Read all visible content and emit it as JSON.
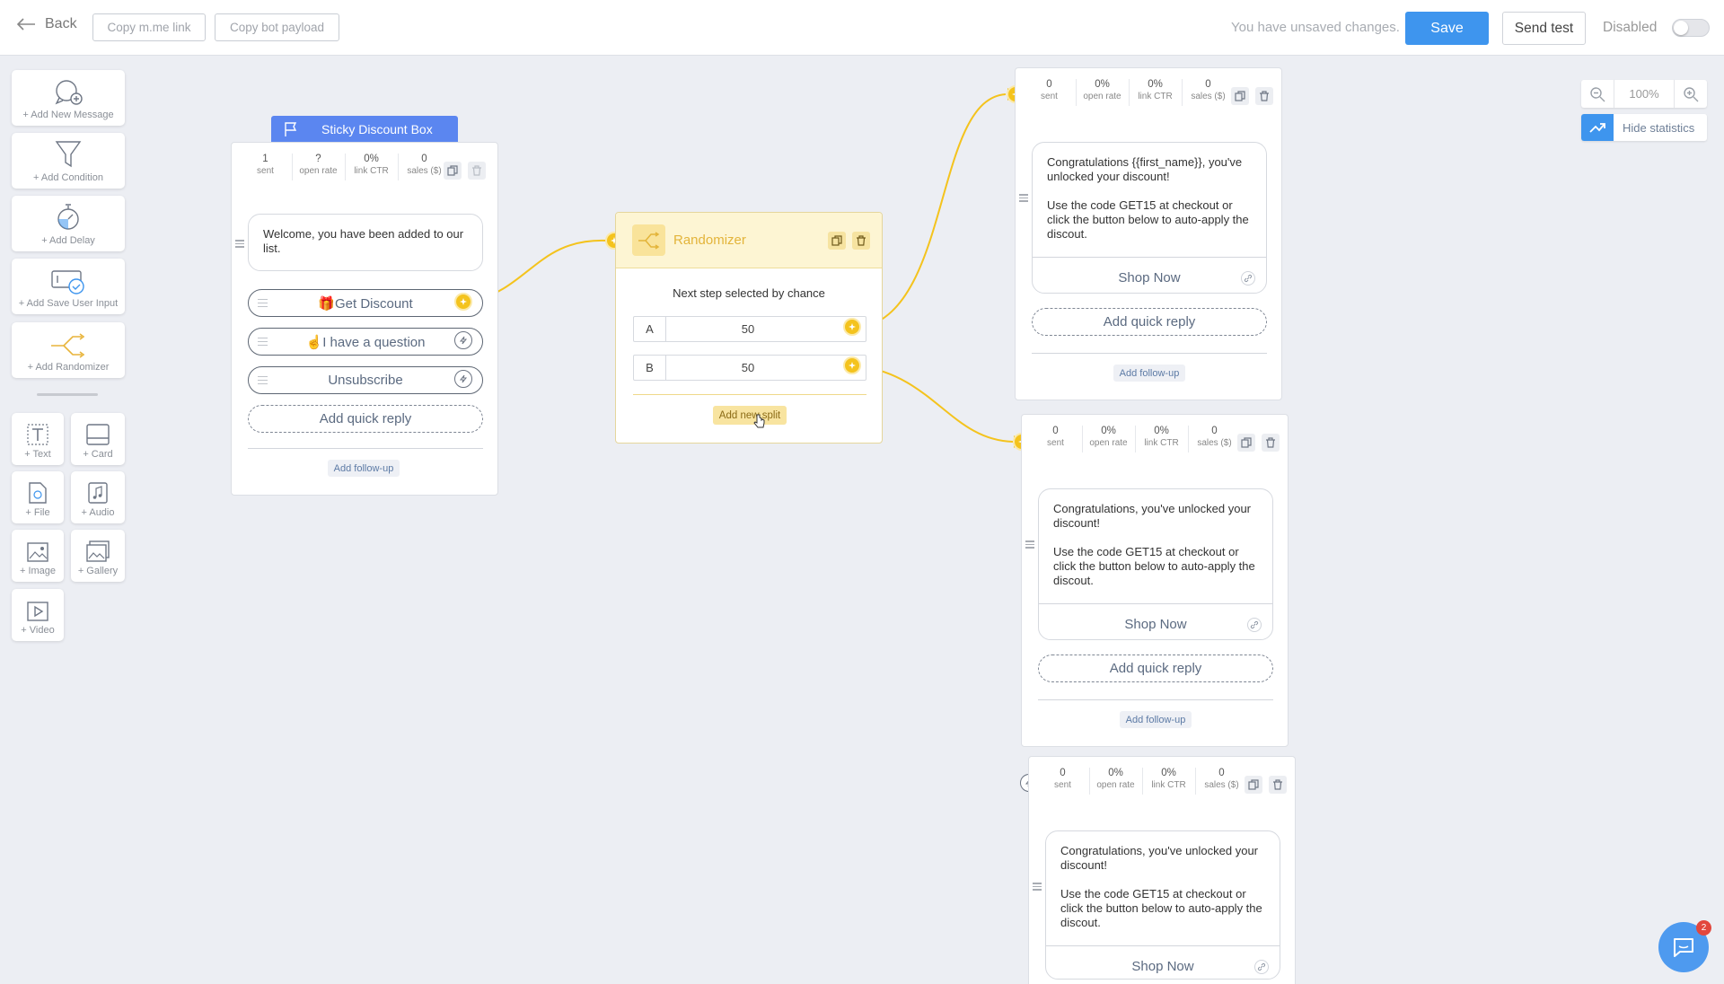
{
  "topbar": {
    "back": "Back",
    "copy_link": "Copy m.me link",
    "copy_payload": "Copy bot payload",
    "unsaved": "You have unsaved changes.",
    "save": "Save",
    "send_test": "Send test",
    "disabled": "Disabled"
  },
  "palette": {
    "add_message": "+ Add New Message",
    "add_condition": "+ Add Condition",
    "add_delay": "+ Add Delay",
    "add_save_input": "+ Add Save User Input",
    "add_randomizer": "+ Add Randomizer",
    "text": "+ Text",
    "card": "+ Card",
    "file": "+ File",
    "audio": "+ Audio",
    "image": "+ Image",
    "gallery": "+ Gallery",
    "video": "+ Video"
  },
  "zoom": {
    "value": "100%",
    "hide_stats": "Hide statistics"
  },
  "stat_labels": {
    "sent": "sent",
    "open": "open rate",
    "ctr": "link CTR",
    "sales": "sales ($)"
  },
  "sticky": {
    "title": "Sticky Discount Box",
    "sent": "1",
    "open": "?",
    "ctr": "0%",
    "sales": "0",
    "message": "Welcome, you have been added to our list.",
    "qr1": "🎁Get Discount",
    "qr2": "☝️I have a question",
    "qr3": "Unsubscribe",
    "add_qr": "Add quick reply",
    "followup": "Add follow-up"
  },
  "randomizer": {
    "title": "Randomizer",
    "subtitle": "Next step selected by chance",
    "a_label": "A",
    "a_value": "50",
    "b_label": "B",
    "b_value": "50",
    "pct": "%",
    "add_split": "Add new split"
  },
  "msg1": {
    "sent": "0",
    "open": "0%",
    "ctr": "0%",
    "sales": "0",
    "line1": "Congratulations {{first_name}}, you've unlocked your discount!",
    "line2": "Use the code GET15 at checkout or click the button below to auto-apply the discout.",
    "shop": "Shop Now",
    "add_qr": "Add quick reply",
    "followup": "Add follow-up"
  },
  "msg2": {
    "sent": "0",
    "open": "0%",
    "ctr": "0%",
    "sales": "0",
    "line1": "Congratulations, you've unlocked your discount!",
    "line2": "Use the code GET15 at checkout or click the button below to auto-apply the discout.",
    "shop": "Shop Now",
    "add_qr": "Add quick reply",
    "followup": "Add follow-up"
  },
  "msg3": {
    "sent": "0",
    "open": "0%",
    "ctr": "0%",
    "sales": "0",
    "line1": "Congratulations, you've unlocked your discount!",
    "line2": "Use the code GET15 at checkout or click the button below to auto-apply the discout.",
    "shop": "Shop Now"
  },
  "chat": {
    "badge": "2"
  },
  "colors": {
    "accent": "#3e95ee",
    "connector": "#f4c31d",
    "header": "#5b86f0"
  }
}
